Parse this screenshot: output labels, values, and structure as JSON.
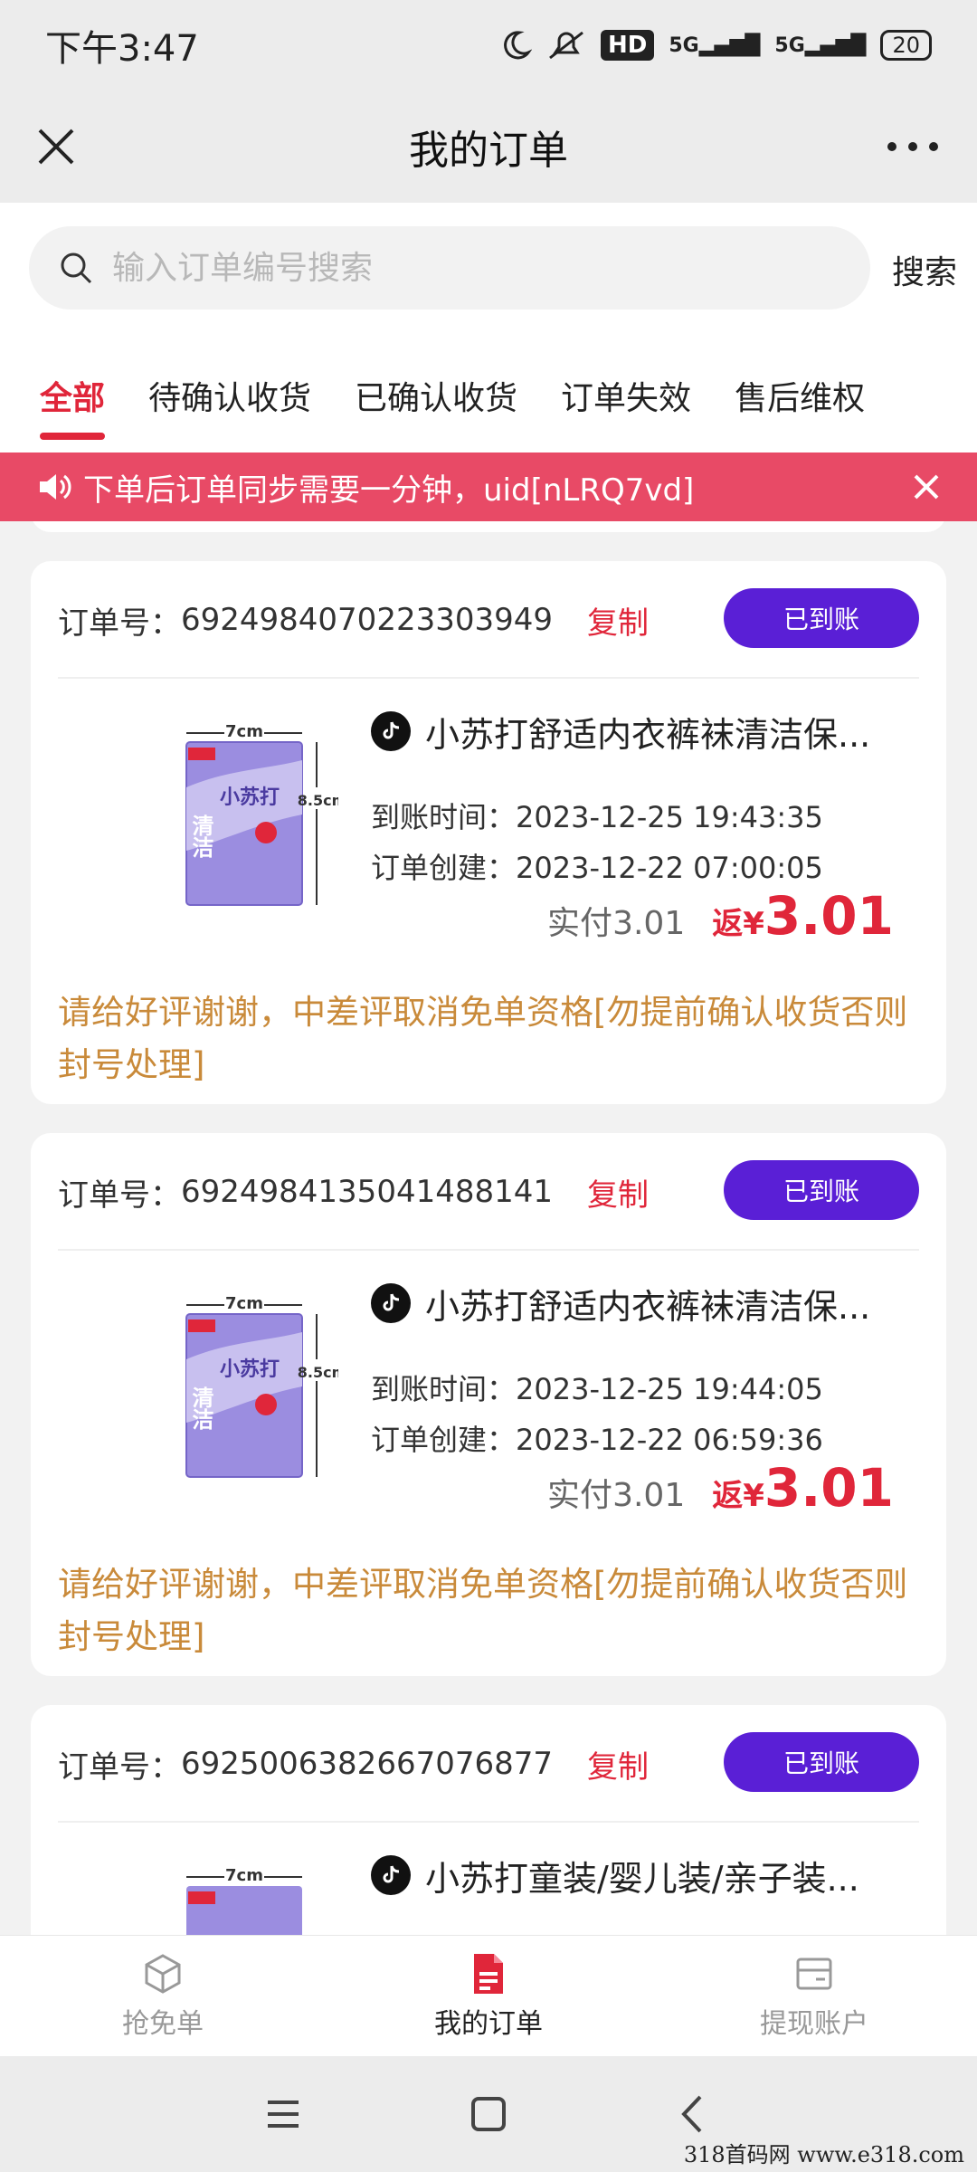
{
  "status_bar": {
    "time": "下午3:47",
    "hd": "HD",
    "net1": "5G",
    "net2": "5G",
    "battery": "20"
  },
  "header": {
    "title": "我的订单"
  },
  "search": {
    "placeholder": "输入订单编号搜索",
    "button": "搜索"
  },
  "tabs": [
    {
      "label": "全部",
      "active": true
    },
    {
      "label": "待确认收货"
    },
    {
      "label": "已确认收货"
    },
    {
      "label": "订单失效"
    },
    {
      "label": "售后维权"
    }
  ],
  "notice": {
    "text": "下单后订单同步需要一分钟，uid[nLRQ7vd]"
  },
  "labels": {
    "order_no": "订单号：",
    "copy": "复制",
    "arrival_time": "到账时间：",
    "created": "订单创建：",
    "paid_prefix": "实付",
    "rebate_prefix": "返",
    "currency": "¥"
  },
  "orders": [
    {
      "order_no": "6924984070223303949",
      "status": "已到账",
      "title": "小苏打舒适内衣裤袜清洁保...",
      "arrival_time": "2023-12-25 19:43:35",
      "created": "2023-12-22 07:00:05",
      "paid": "3.01",
      "rebate": "3.01",
      "note": "请给好评谢谢，中差评取消免单资格[勿提前确认收货否则封号处理]"
    },
    {
      "order_no": "6924984135041488141",
      "status": "已到账",
      "title": "小苏打舒适内衣裤袜清洁保...",
      "arrival_time": "2023-12-25 19:44:05",
      "created": "2023-12-22 06:59:36",
      "paid": "3.01",
      "rebate": "3.01",
      "note": "请给好评谢谢，中差评取消免单资格[勿提前确认收货否则封号处理]"
    },
    {
      "order_no": "6925006382667076877",
      "status": "已到账",
      "title": "小苏打童装/婴儿装/亲子装..."
    }
  ],
  "product_image": {
    "width_label": "7cm",
    "height_label": "8.5cm",
    "brand": "清洁",
    "name": "小苏打"
  },
  "bottom_nav": [
    {
      "label": "抢免单",
      "icon": "cube-icon"
    },
    {
      "label": "我的订单",
      "icon": "document-icon",
      "active": true
    },
    {
      "label": "提现账户",
      "icon": "card-icon"
    }
  ],
  "watermark": "318首码网 www.e318.com"
}
